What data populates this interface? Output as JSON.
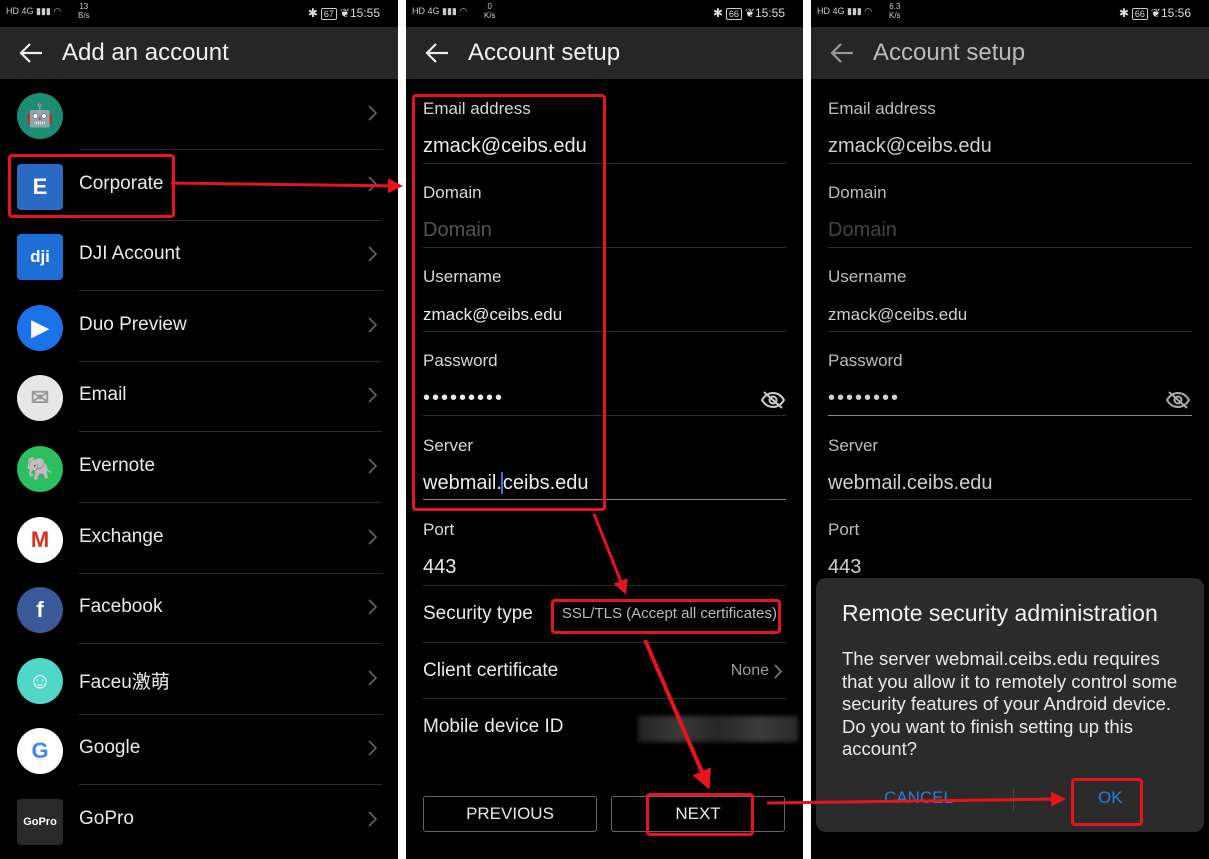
{
  "screen1": {
    "status": {
      "left_icons": "HD 4G ▮▮▮ ◠",
      "speed_value": "13",
      "speed_unit": "B/s",
      "battery": "67",
      "time": "15:55"
    },
    "title": "Add an account",
    "items": [
      {
        "label": "",
        "icon": "android-icon",
        "color": "#1a8d73"
      },
      {
        "label": "Corporate",
        "icon": "exchange-corporate-icon",
        "color": "#2a6ac2"
      },
      {
        "label": "DJI Account",
        "icon": "dji-icon",
        "color": "#1d6fd6"
      },
      {
        "label": "Duo Preview",
        "icon": "duo-icon",
        "color": "#1a73e8"
      },
      {
        "label": "Email",
        "icon": "email-icon",
        "color": "#e6e6e6"
      },
      {
        "label": "Evernote",
        "icon": "evernote-icon",
        "color": "#2dbe60"
      },
      {
        "label": "Exchange",
        "icon": "gmail-icon",
        "color": "#ffffff"
      },
      {
        "label": "Facebook",
        "icon": "facebook-icon",
        "color": "#3b5998"
      },
      {
        "label": "Faceu激萌",
        "icon": "faceu-icon",
        "color": "#4fd6c7"
      },
      {
        "label": "Google",
        "icon": "google-icon",
        "color": "#ffffff"
      },
      {
        "label": "GoPro",
        "icon": "gopro-icon",
        "color": "#2a2a2a"
      }
    ]
  },
  "screen2": {
    "status": {
      "left_icons": "HD 4G ▮▮▮ ◠",
      "speed_value": "0",
      "speed_unit": "K/s",
      "battery": "66",
      "time": "15:55"
    },
    "title": "Account setup",
    "email_label": "Email address",
    "email_value": "zmack@ceibs.edu",
    "domain_label": "Domain",
    "domain_placeholder": "Domain",
    "username_label": "Username",
    "username_value": "zmack@ceibs.edu",
    "password_label": "Password",
    "password_value": "•••••••••",
    "server_label": "Server",
    "server_value_a": "webmail.",
    "server_value_b": "ceibs.edu",
    "port_label": "Port",
    "port_value": "443",
    "security_label": "Security type",
    "security_value": "SSL/TLS (Accept all certificates)",
    "cert_label": "Client certificate",
    "cert_value": "None",
    "device_label": "Mobile device ID",
    "prev_label": "PREVIOUS",
    "next_label": "NEXT"
  },
  "screen3": {
    "status": {
      "left_icons": "HD 4G ▮▮▮ ◠",
      "speed_value": "6.3",
      "speed_unit": "K/s",
      "battery": "66",
      "time": "15:56"
    },
    "title": "Account setup",
    "email_label": "Email address",
    "email_value": "zmack@ceibs.edu",
    "domain_label": "Domain",
    "domain_placeholder": "Domain",
    "username_label": "Username",
    "username_value": "zmack@ceibs.edu",
    "password_label": "Password",
    "password_value": "••••••••",
    "server_label": "Server",
    "server_value": "webmail.ceibs.edu",
    "port_label": "Port",
    "port_value": "443",
    "dialog": {
      "title": "Remote security administration",
      "body": "The server webmail.ceibs.edu requires that you allow it to remotely control some security features of your Android device. Do you want to finish setting up this account?",
      "cancel_label": "CANCEL",
      "ok_label": "OK"
    }
  },
  "annotation_color": "#e8141c"
}
